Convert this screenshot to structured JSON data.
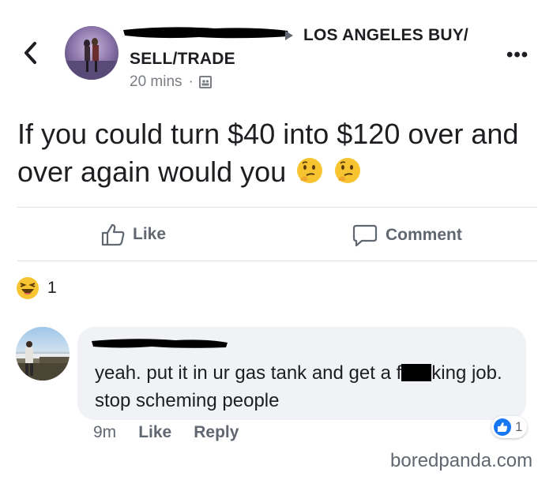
{
  "header": {
    "group_name_line1": "LOS ANGELES BUY/",
    "group_name_line2": "SELL/TRADE",
    "time": "20 mins",
    "separator": "·",
    "icons": [
      "back-chevron-icon",
      "more-dots-icon",
      "audience-icon"
    ]
  },
  "post": {
    "text": "If you could turn $40 into $120 over and over again would you",
    "emojis": [
      "thinking-face",
      "thinking-face"
    ]
  },
  "actions": {
    "like_label": "Like",
    "comment_label": "Comment"
  },
  "reactions": {
    "type": "haha",
    "count": "1"
  },
  "comment": {
    "text_before": "yeah. put it in ur gas tank and get a f",
    "text_after": "king job. stop scheming people",
    "time": "9m",
    "like_label": "Like",
    "reply_label": "Reply",
    "reaction_count": "1"
  },
  "watermark": "boredpanda.com",
  "colors": {
    "text": "#1c1e21",
    "secondary": "#606770",
    "divider": "#dadde1",
    "bubble": "#f0f2f5",
    "like_blue": "#1877f2",
    "emoji_yellow": "#f7c531"
  }
}
